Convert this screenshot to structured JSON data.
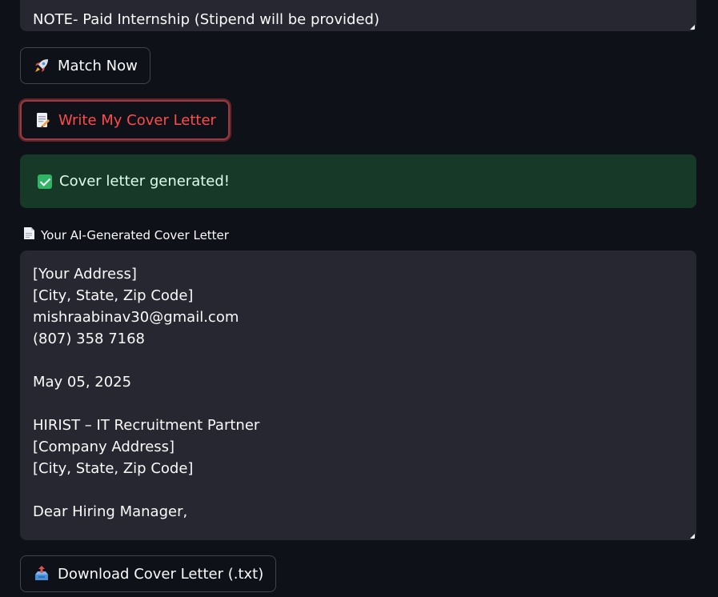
{
  "top_textarea": {
    "visible_line": "NOTE- Paid Internship (Stipend will be provided)"
  },
  "buttons": {
    "match_now": {
      "icon": "rocket-icon",
      "label": "Match Now"
    },
    "write_cover_letter": {
      "icon": "memo-icon",
      "label": "Write My Cover Letter"
    },
    "download": {
      "icon": "outbox-tray-icon",
      "label": "Download Cover Letter (.txt)"
    }
  },
  "alert": {
    "icon": "check-mark-icon",
    "text": "Cover letter generated!"
  },
  "cover_letter": {
    "label": "Your AI-Generated Cover Letter",
    "label_icon": "page-icon",
    "lines": [
      "[Your Address]",
      "[City, State, Zip Code]",
      "mishraabinav30@gmail.com",
      "(807) 358 7168",
      "",
      "May 05, 2025",
      "",
      "HIRIST – IT Recruitment Partner",
      "[Company Address]",
      "[City, State, Zip Code]",
      "",
      "Dear Hiring Manager,"
    ]
  },
  "colors": {
    "background": "#0e1117",
    "field_bg": "#262730",
    "accent_red": "#ff4b4b",
    "success_bg": "#173928"
  }
}
